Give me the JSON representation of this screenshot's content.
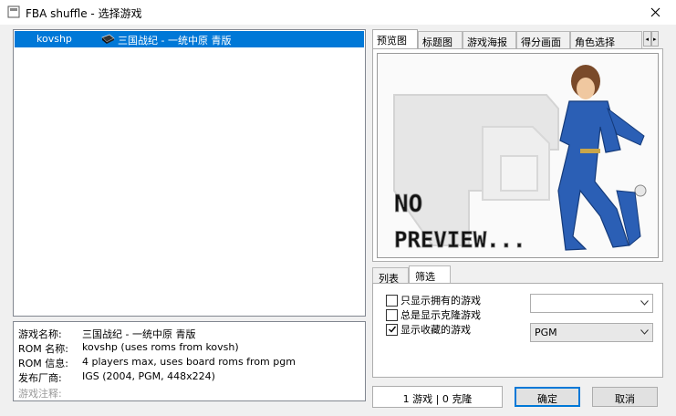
{
  "window": {
    "title": "FBA shuffle - 选择游戏",
    "close_icon": "close-icon"
  },
  "game_list": {
    "rows": [
      {
        "rom": "kovshp",
        "icon": "cartridge-icon",
        "title": "三国战纪 - 一统中原 青版"
      }
    ]
  },
  "info": {
    "rows": [
      {
        "label": "游戏名称:",
        "value": "三国战纪 - 一统中原 青版"
      },
      {
        "label": "ROM 名称:",
        "value": "kovshp (uses roms from kovsh)"
      },
      {
        "label": "ROM 信息:",
        "value": "4 players max, uses board roms from pgm"
      },
      {
        "label": "发布厂商:",
        "value": "IGS (2004, PGM, 448x224)"
      },
      {
        "label": "游戏注释:",
        "value": ""
      }
    ]
  },
  "preview_tabs": {
    "items": [
      "预览图",
      "标题图",
      "游戏海报",
      "得分画面",
      "角色选择"
    ],
    "active": "预览图"
  },
  "preview": {
    "line1": "NO",
    "line2": "PREVIEW..."
  },
  "filter_tabs": {
    "items": [
      "列表",
      "筛选"
    ],
    "active": "筛选"
  },
  "filters": {
    "checkboxes": [
      {
        "label": "只显示拥有的游戏",
        "checked": false
      },
      {
        "label": "总是显示克隆游戏",
        "checked": false
      },
      {
        "label": "显示收藏的游戏",
        "checked": true
      }
    ],
    "dropdown1_value": "",
    "dropdown2_value": "PGM"
  },
  "status": {
    "text": "1 游戏 | 0 克隆"
  },
  "buttons": {
    "ok": "确定",
    "cancel": "取消"
  },
  "colors": {
    "selection": "#0078d7",
    "default_button_border": "#0078d7"
  }
}
